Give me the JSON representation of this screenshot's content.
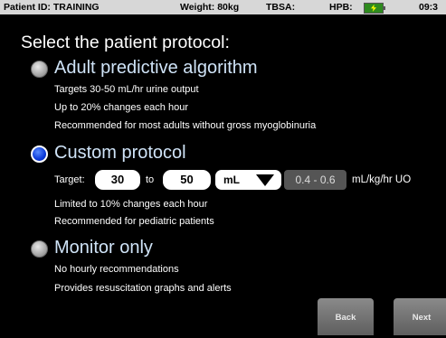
{
  "status_bar": {
    "patient_id": "Patient ID: TRAINING",
    "weight": "Weight: 80kg",
    "tbsa": "TBSA:",
    "hpb": "HPB:",
    "time": "09:3"
  },
  "heading": "Select the patient protocol:",
  "options": [
    {
      "title": "Adult predictive algorithm",
      "selected": false,
      "lines": [
        "Targets  30-50 mL/hr urine output",
        "Up to  20% changes each hour",
        "Recommended for most adults without gross myoglobinuria"
      ]
    },
    {
      "title": "Custom protocol",
      "selected": true,
      "target_label": "Target:",
      "target_low": "30",
      "to_label": "to",
      "target_high": "50",
      "unit": "mL",
      "range": "0.4 - 0.6",
      "range_unit": "mL/kg/hr UO",
      "lines": [
        "Limited to  10% changes each hour",
        "Recommended for pediatric patients"
      ]
    },
    {
      "title": "Monitor only",
      "selected": false,
      "lines": [
        "No hourly recommendations",
        "Provides resuscitation graphs and alerts"
      ]
    }
  ],
  "buttons": {
    "back": "Back",
    "next": "Next"
  },
  "colors": {
    "selected_radio": "#1a4cf0",
    "option_title": "#cfe3f7",
    "battery": "#2e8b1e"
  }
}
